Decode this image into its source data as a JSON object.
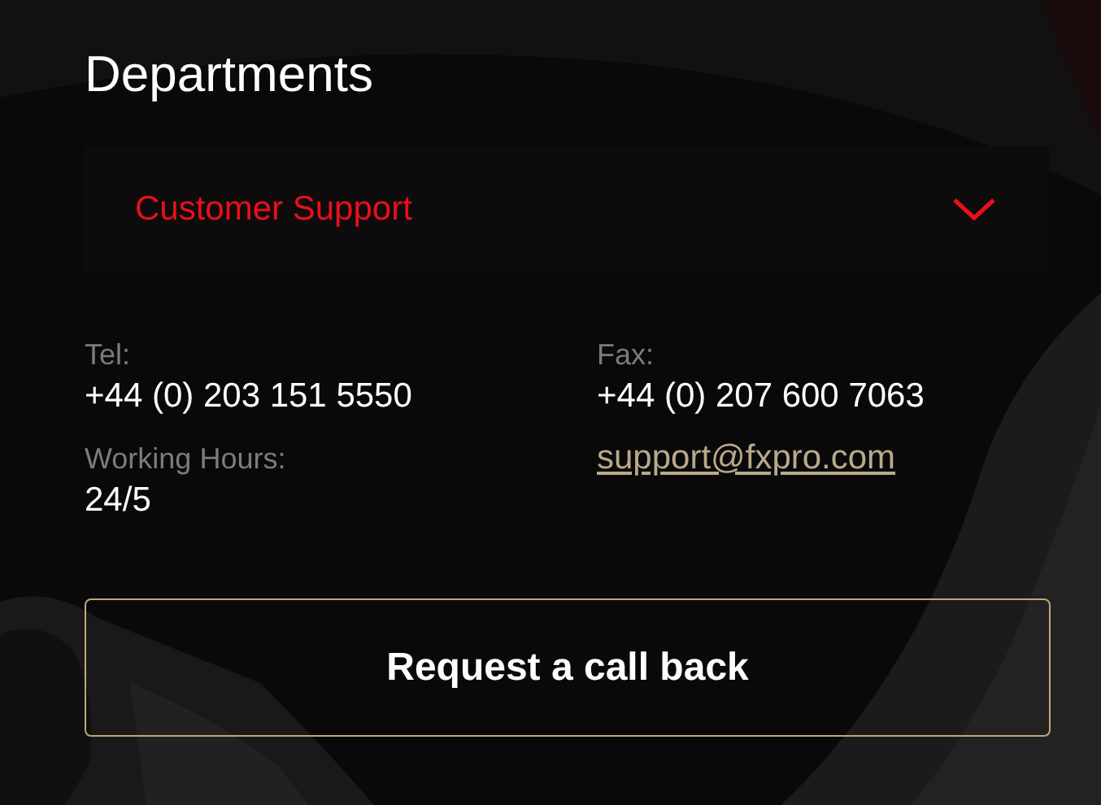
{
  "title": "Departments",
  "department_select": {
    "value": "Customer Support"
  },
  "contacts": [
    {
      "kind": "info",
      "label": "Tel:",
      "value": "+44 (0) 203 151 5550"
    },
    {
      "kind": "info",
      "label": "Fax:",
      "value": "+44 (0) 207 600 7063"
    },
    {
      "kind": "info",
      "label": "Working Hours:",
      "value": "24/5"
    },
    {
      "kind": "email",
      "value": "support@fxpro.com"
    }
  ],
  "button": "Request a call back"
}
